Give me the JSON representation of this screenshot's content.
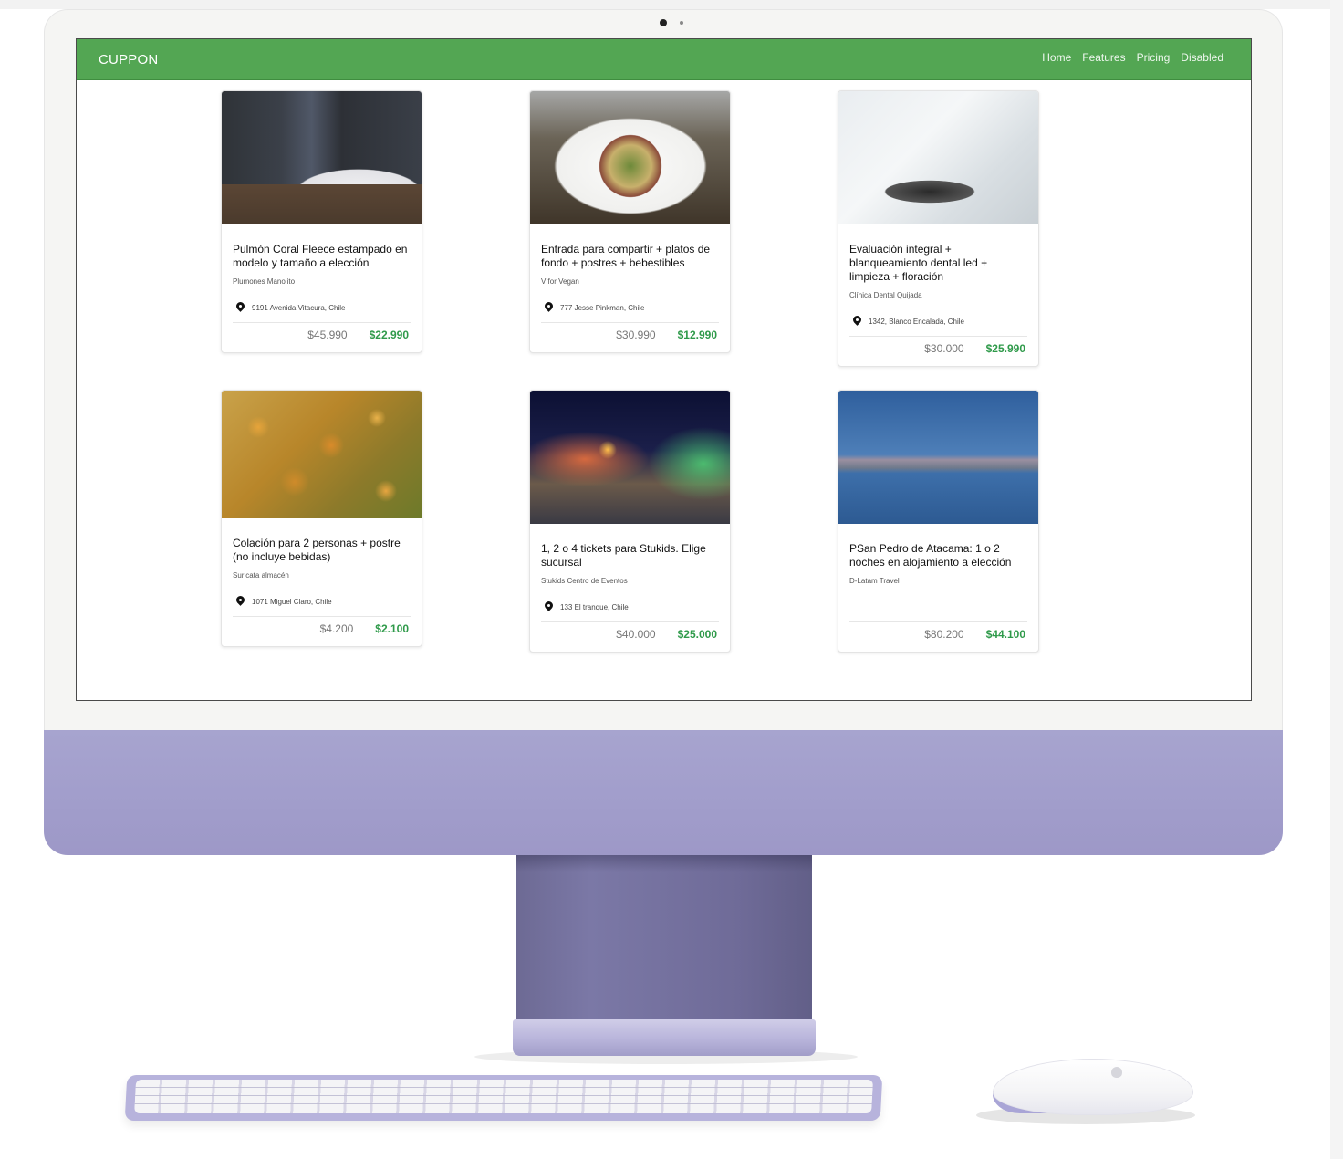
{
  "app": {
    "brand": "CUPPON",
    "nav": [
      "Home",
      "Features",
      "Pricing",
      "Disabled"
    ]
  },
  "cards": [
    {
      "title": "Pulmón Coral Fleece estampado en modelo y tamaño a elección",
      "merchant": "Plumones Manolito",
      "location": "9191 Avenida Vitacura, Chile",
      "price_old": "$45.990",
      "price_new": "$22.990",
      "image": "bedroom-photo"
    },
    {
      "title": "Entrada para compartir + platos de fondo + postres + bebestibles",
      "merchant": "V for Vegan",
      "location": "777 Jesse Pinkman, Chile",
      "price_old": "$30.990",
      "price_new": "$12.990",
      "image": "salad-photo"
    },
    {
      "title": "Evaluación integral + blanqueamiento dental led + limpieza + floración",
      "merchant": "Clínica Dental Quijada",
      "location": "1342, Blanco Encalada, Chile",
      "price_old": "$30.000",
      "price_new": "$25.990",
      "image": "dental-chair-photo"
    },
    {
      "title": "Colación para 2 personas + postre (no incluye bebidas)",
      "merchant": "Suricata almacén",
      "location": "1071 Miguel Claro, Chile",
      "price_old": "$4.200",
      "price_new": "$2.100",
      "image": "food-photo"
    },
    {
      "title": "1, 2 o 4 tickets para Stukids. Elige sucursal",
      "merchant": "Stukids Centro de Eventos",
      "location": "133 El tranque, Chile",
      "price_old": "$40.000",
      "price_new": "$25.000",
      "image": "fair-photo"
    },
    {
      "title": "PSan Pedro de Atacama: 1 o 2 noches en alojamiento a elección",
      "merchant": "D-Latam Travel",
      "location": "",
      "price_old": "$80.200",
      "price_new": "$44.100",
      "image": "lake-photo"
    }
  ],
  "colors": {
    "navbar": "#53a653",
    "price_new": "#2f9a4a",
    "imac_body": "#a7a4cf"
  }
}
